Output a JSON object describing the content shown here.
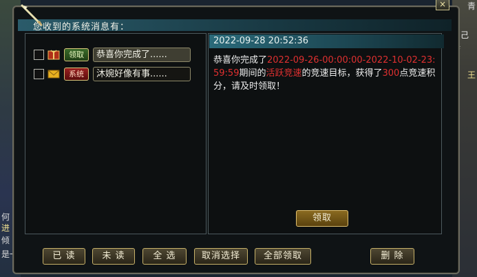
{
  "window": {
    "title": "您收到的系统消息有：",
    "close_label": "×"
  },
  "messages": [
    {
      "tag": "领取",
      "tag_color": "#3a6a2a",
      "subject": "恭喜你完成了......",
      "icon": "gift-icon",
      "selected": true
    },
    {
      "tag": "系统",
      "tag_color": "#9a2020",
      "subject": "沐婉好像有事......",
      "icon": "envelope-icon",
      "selected": false
    }
  ],
  "detail": {
    "datetime": "2022-09-28 20:52:36",
    "parts": [
      {
        "text": "恭喜你完成了",
        "red": false
      },
      {
        "text": "2022-09-26-00:00:00-2022-10-02-23:59:59",
        "red": true
      },
      {
        "text": "期间的",
        "red": false
      },
      {
        "text": "活跃竞速",
        "red": true
      },
      {
        "text": "的竞速目标，获得了",
        "red": false
      },
      {
        "text": "300",
        "red": true
      },
      {
        "text": "点竞速积分，请及时领取！",
        "red": false
      }
    ],
    "claim_label": "领取"
  },
  "buttons": {
    "read": "已 读",
    "unread": "未 读",
    "select_all": "全 选",
    "cancel_select": "取消选择",
    "claim_all": "全部领取",
    "delete": "删 除"
  },
  "background": {
    "right_texts": [
      "青",
      "自己修",
      "王"
    ],
    "left_texts": [
      "何",
      "进",
      "倾",
      "是一"
    ]
  }
}
